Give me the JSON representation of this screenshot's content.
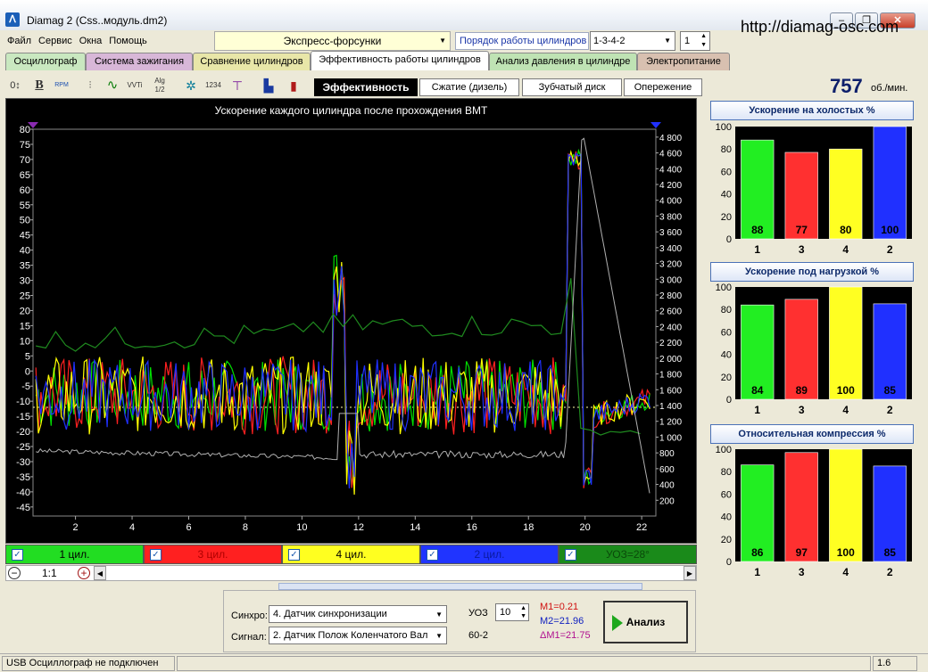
{
  "window": {
    "app_title": "Diamag 2 (Css..модуль.dm2)",
    "url": "http://diamag-osc.com",
    "buttons": {
      "minimize": "–",
      "maximize": "❐",
      "close": "✕"
    }
  },
  "menu": [
    "Файл",
    "Сервис",
    "Окна",
    "Помощь"
  ],
  "mode_select": "Экспресс-форсунки",
  "cylinder_order_label": "Порядок работы цилиндров",
  "cylinder_order_value": "1-3-4-2",
  "cylinder_spin_value": "1",
  "tabs": [
    {
      "label": "Осциллограф",
      "color": "#c9e8c0"
    },
    {
      "label": "Система зажигания",
      "color": "#d8b7d8"
    },
    {
      "label": "Сравнение цилиндров",
      "color": "#e8e6a8"
    },
    {
      "label": "Эффективность работы цилиндров",
      "color": "#ffffff",
      "active": true
    },
    {
      "label": "Анализ давления в цилиндре",
      "color": "#bfe3b4"
    },
    {
      "label": "Электропитание",
      "color": "#d8c0b0"
    }
  ],
  "toolbar_icons": [
    "offset-icon",
    "bold-b-icon",
    "rpm-icon",
    "scale-icon",
    "wave-icon",
    "vvti-icon",
    "algorithm-icon",
    "bug-icon",
    "timing-icon",
    "marker-icon",
    "car-icon",
    "bars-icon"
  ],
  "toolbar_labels": {
    "bold": "B",
    "rpm": "RPM",
    "vvti": "VVTi",
    "alg": "Alg 1/2",
    "timing": "1234"
  },
  "subtabs": [
    {
      "label": "Эффективность",
      "active": true
    },
    {
      "label": "Сжатие (дизель)"
    },
    {
      "label": "Зубчатый диск"
    },
    {
      "label": "Опережение"
    }
  ],
  "rpm": {
    "value": "757",
    "unit": "об./мин."
  },
  "chart_data": {
    "type": "line",
    "title": "Ускорение каждого цилиндра после прохождения ВМТ",
    "x_ticks": [
      2,
      4,
      6,
      8,
      10,
      12,
      14,
      16,
      18,
      20,
      22
    ],
    "y_left_ticks": [
      80,
      75,
      70,
      65,
      60,
      55,
      50,
      45,
      40,
      35,
      30,
      25,
      20,
      15,
      10,
      5,
      0,
      -5,
      -10,
      -15,
      -20,
      -25,
      -30,
      -35,
      -40,
      -45
    ],
    "y_right_ticks": [
      "4 800",
      "4 600",
      "4 400",
      "4 200",
      "4 000",
      "3 800",
      "3 600",
      "3 400",
      "3 200",
      "3 000",
      "2 800",
      "2 600",
      "2 400",
      "2 200",
      "2 000",
      "1 800",
      "1 600",
      "1 400",
      "1 200",
      "1 000",
      "800",
      "600",
      "400",
      "200"
    ],
    "xlim": [
      0.5,
      22.5
    ],
    "ylim": [
      -48,
      80
    ],
    "y2lim": [
      0,
      4900
    ],
    "series_colors": {
      "c1": "#00e000",
      "c3": "#ff2020",
      "c4": "#ffff00",
      "c2": "#2030ff",
      "uoz": "#1f8a1f",
      "rpm": "#b0b0b0"
    }
  },
  "legend": [
    {
      "label": "1 цил.",
      "bg": "#22dd22",
      "fg": "#000"
    },
    {
      "label": "3 цил.",
      "bg": "#ff2020",
      "fg": "#b00000"
    },
    {
      "label": "4 цил.",
      "bg": "#ffff20",
      "fg": "#000"
    },
    {
      "label": "2 цил.",
      "bg": "#2034ff",
      "fg": "#0a1aa0"
    },
    {
      "label": "УОЗ=28°",
      "bg": "#1a8a1a",
      "fg": "#0a4a0a"
    }
  ],
  "zoom": {
    "minus": "−",
    "ratio": "1:1",
    "plus": "+"
  },
  "panels": [
    {
      "title": "Ускорение на холостых %",
      "values": [
        88,
        77,
        80,
        100
      ],
      "labels": [
        "1",
        "3",
        "4",
        "2"
      ]
    },
    {
      "title": "Ускорение под нагрузкой %",
      "values": [
        84,
        89,
        100,
        85
      ],
      "labels": [
        "1",
        "3",
        "4",
        "2"
      ]
    },
    {
      "title": "Относительная компрессия %",
      "values": [
        86,
        97,
        100,
        85
      ],
      "labels": [
        "1",
        "3",
        "4",
        "2"
      ]
    }
  ],
  "bar_colors": [
    "#22ee22",
    "#ff3030",
    "#ffff22",
    "#2030ff"
  ],
  "bar_axis_ticks": [
    100,
    80,
    60,
    40,
    20,
    0
  ],
  "bottom": {
    "sync_label": "Синхро:",
    "sync_value": "4. Датчик синхронизации",
    "signal_label": "Сигнал:",
    "signal_value": "2. Датчик Полож Коленчатого Вал",
    "uoz_label": "УОЗ",
    "uoz_value": "10",
    "wheel_label": "60-2",
    "m1": "M1=0.21",
    "m2": "M2=21.96",
    "dm1": "ΔM1=21.75",
    "analyze": "Анализ"
  },
  "status": {
    "usb": "USB Осциллограф не подключен",
    "version": "1.6"
  }
}
